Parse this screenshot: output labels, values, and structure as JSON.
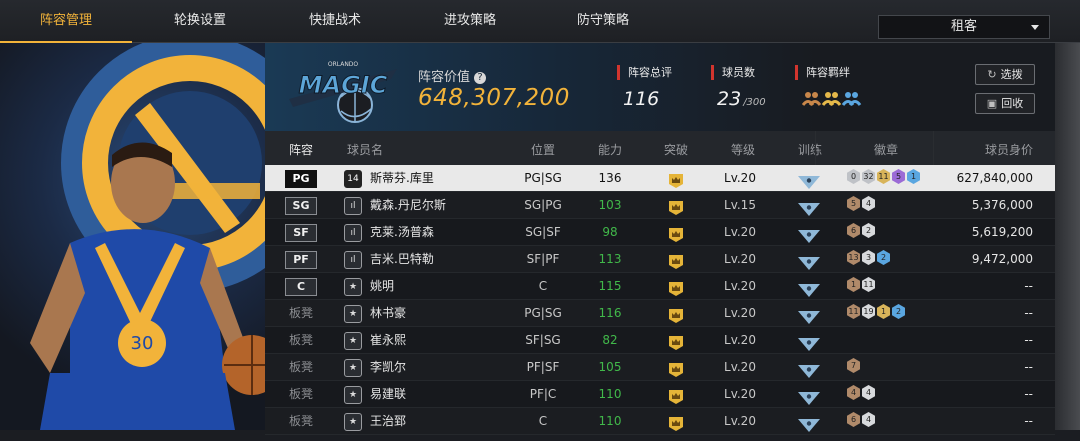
{
  "tabs": [
    {
      "label": "阵容管理",
      "active": true
    },
    {
      "label": "轮换设置",
      "active": false
    },
    {
      "label": "快捷战术",
      "active": false
    },
    {
      "label": "进攻策略",
      "active": false
    },
    {
      "label": "防守策略",
      "active": false
    }
  ],
  "dropdown": {
    "selected": "租客"
  },
  "team": {
    "logo_text": "MAGIC",
    "logo_subtext": "ORLANDO"
  },
  "roster_value": {
    "label": "阵容价值",
    "value": "648,307,200"
  },
  "stats": {
    "overall": {
      "label": "阵容总评",
      "value": "116"
    },
    "players": {
      "label": "球员数",
      "value": "23",
      "max": "/300"
    },
    "bonds": {
      "label": "阵容羁绊"
    }
  },
  "buttons": {
    "select": "选拨",
    "recycle": "回收"
  },
  "columns": {
    "position": "阵容",
    "name": "球员名",
    "pos": "位置",
    "rating": "能力",
    "breakthrough": "突破",
    "level": "等级",
    "training": "训练",
    "badges": "徽章",
    "value": "球员身价"
  },
  "colors": {
    "accent": "#f2b33a",
    "rating_green": "#41b84a",
    "stat_red": "#d2352e"
  },
  "players": [
    {
      "slot": "PG",
      "starter": true,
      "tier": "14",
      "name": "斯蒂芬.库里",
      "pos": "PG|SG",
      "rating": "136",
      "level": "Lv.20",
      "badges": [
        {
          "n": "0",
          "c": "#bfc2c7"
        },
        {
          "n": "32",
          "c": "#bfc2c7"
        },
        {
          "n": "11",
          "c": "#d8b45a"
        },
        {
          "n": "5",
          "c": "#9b6bd6"
        },
        {
          "n": "1",
          "c": "#5aa6e0"
        }
      ],
      "value": "627,840,000"
    },
    {
      "slot": "SG",
      "starter": true,
      "tier": "ıl",
      "name": "戴森.丹尼尔斯",
      "pos": "SG|PG",
      "rating": "103",
      "level": "Lv.15",
      "badges": [
        {
          "n": "5",
          "c": "#b08a6a"
        },
        {
          "n": "4",
          "c": "#d7d9dc"
        }
      ],
      "value": "5,376,000"
    },
    {
      "slot": "SF",
      "starter": true,
      "tier": "ıl",
      "name": "克莱.汤普森",
      "pos": "SG|SF",
      "rating": "98",
      "level": "Lv.20",
      "badges": [
        {
          "n": "6",
          "c": "#b08a6a"
        },
        {
          "n": "2",
          "c": "#d7d9dc"
        }
      ],
      "value": "5,619,200"
    },
    {
      "slot": "PF",
      "starter": true,
      "tier": "ıl",
      "name": "吉米.巴特勒",
      "pos": "SF|PF",
      "rating": "113",
      "level": "Lv.20",
      "badges": [
        {
          "n": "13",
          "c": "#b08a6a"
        },
        {
          "n": "3",
          "c": "#d7d9dc"
        },
        {
          "n": "2",
          "c": "#5aa6e0"
        }
      ],
      "value": "9,472,000"
    },
    {
      "slot": "C",
      "starter": true,
      "tier": "★",
      "name": "姚明",
      "pos": "C",
      "rating": "115",
      "level": "Lv.20",
      "badges": [
        {
          "n": "1",
          "c": "#b08a6a"
        },
        {
          "n": "11",
          "c": "#d7d9dc"
        }
      ],
      "value": "--"
    },
    {
      "slot": "板凳",
      "starter": false,
      "tier": "★",
      "name": "林书豪",
      "pos": "PG|SG",
      "rating": "116",
      "level": "Lv.20",
      "badges": [
        {
          "n": "11",
          "c": "#b08a6a"
        },
        {
          "n": "19",
          "c": "#d7d9dc"
        },
        {
          "n": "1",
          "c": "#d8b45a"
        },
        {
          "n": "2",
          "c": "#5aa6e0"
        }
      ],
      "value": "--"
    },
    {
      "slot": "板凳",
      "starter": false,
      "tier": "★",
      "name": "崔永熙",
      "pos": "SF|SG",
      "rating": "82",
      "level": "Lv.20",
      "badges": [],
      "value": "--"
    },
    {
      "slot": "板凳",
      "starter": false,
      "tier": "★",
      "name": "李凯尔",
      "pos": "PF|SF",
      "rating": "105",
      "level": "Lv.20",
      "badges": [
        {
          "n": "7",
          "c": "#b08a6a"
        }
      ],
      "value": "--"
    },
    {
      "slot": "板凳",
      "starter": false,
      "tier": "★",
      "name": "易建联",
      "pos": "PF|C",
      "rating": "110",
      "level": "Lv.20",
      "badges": [
        {
          "n": "4",
          "c": "#b08a6a"
        },
        {
          "n": "4",
          "c": "#d7d9dc"
        }
      ],
      "value": "--"
    },
    {
      "slot": "板凳",
      "starter": false,
      "tier": "★",
      "name": "王治郅",
      "pos": "C",
      "rating": "110",
      "level": "Lv.20",
      "badges": [
        {
          "n": "6",
          "c": "#b08a6a"
        },
        {
          "n": "4",
          "c": "#d7d9dc"
        }
      ],
      "value": "--"
    }
  ]
}
